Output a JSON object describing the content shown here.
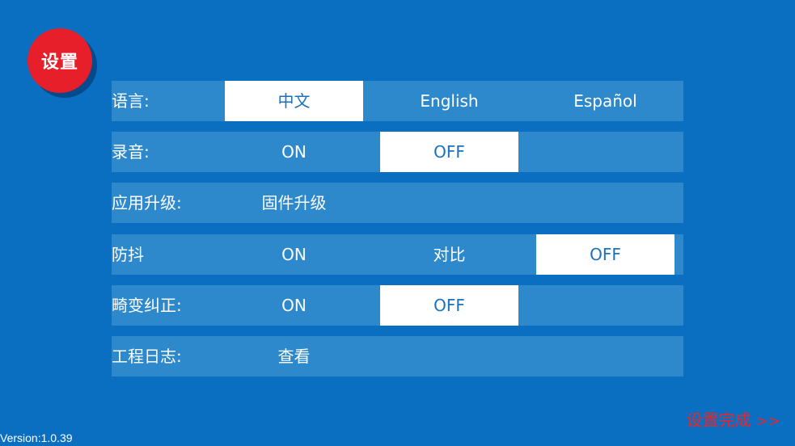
{
  "header": {
    "badge_label": "设置"
  },
  "settings": {
    "language": {
      "label": "语言:",
      "options": [
        "中文",
        "English",
        "Español"
      ],
      "selected": "中文"
    },
    "recording": {
      "label": "录音:",
      "options": [
        "ON",
        "OFF"
      ],
      "selected": "OFF"
    },
    "upgrade": {
      "label": "应用升级:",
      "action": "固件升级"
    },
    "stabilization": {
      "label": "防抖",
      "options": [
        "ON",
        "对比",
        "OFF"
      ],
      "selected": "OFF"
    },
    "distortion": {
      "label": "畸变纠正:",
      "options": [
        "ON",
        "OFF"
      ],
      "selected": "OFF"
    },
    "log": {
      "label": "工程日志:",
      "action": "查看"
    }
  },
  "footer": {
    "version": "Version:1.0.39",
    "done_label": "设置完成",
    "done_arrows": ">>"
  },
  "colors": {
    "background": "#0a6fc0",
    "row": "#2d89cc",
    "selected_bg": "#ffffff",
    "selected_text": "#1a72bd",
    "badge": "#e61f2a",
    "done_text": "#e8262c"
  }
}
